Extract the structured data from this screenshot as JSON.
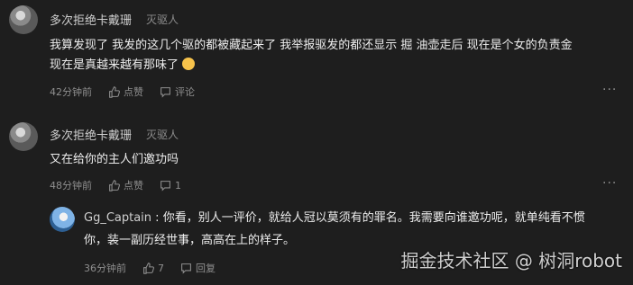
{
  "comments": [
    {
      "author": "多次拒绝卡戴珊",
      "role": "灭驱人",
      "line1": "我算发现了 我发的这几个驱的都被藏起来了 我举报驱发的都还显示 掘 油壶走后 现在是个女的负责金",
      "line2": "现在是真越来越有那味了",
      "time": "42分钟前",
      "like_label": "点赞",
      "reply_label": "评论",
      "more": "···"
    },
    {
      "author": "多次拒绝卡戴珊",
      "role": "灭驱人",
      "line1": "又在给你的主人们邀功吗",
      "time": "48分钟前",
      "like_label": "点赞",
      "reply_count": "1",
      "more": "···"
    }
  ],
  "reply": {
    "author": "Gg_Captain",
    "line1": " : 你看，别人一评价，就给人冠以莫须有的罪名。我需要向谁邀功呢，就单纯看不惯",
    "line2": "你，装一副历经世事，高高在上的样子。",
    "time": "36分钟前",
    "like_count": "7",
    "reply_label": "回复"
  },
  "watermark": "掘金技术社区 @ 树洞robot",
  "icons": {
    "like": "thumbs-up-icon",
    "comment": "comment-bubble-icon",
    "more": "more-dots-icon",
    "emoji": "smiling-cat-emoji"
  }
}
